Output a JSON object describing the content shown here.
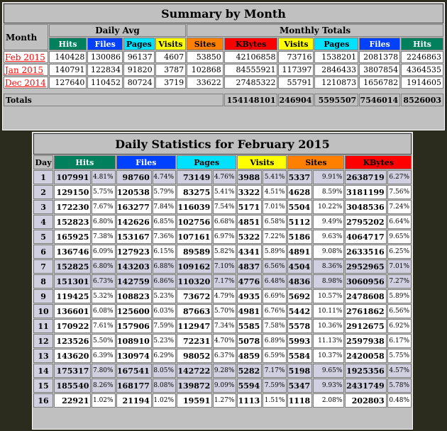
{
  "summary": {
    "title": "Summary by Month",
    "month_label": "Month",
    "daily_avg_label": "Daily Avg",
    "monthly_totals_label": "Monthly Totals",
    "daily_cols": [
      "Hits",
      "Files",
      "Pages",
      "Visits"
    ],
    "monthly_cols": [
      "Sites",
      "KBytes",
      "Visits",
      "Pages",
      "Files",
      "Hits"
    ],
    "rows": [
      {
        "month": "Feb 2015",
        "cells": [
          "140428",
          "130086",
          "96137",
          "4607",
          "53850",
          "42106858",
          "73716",
          "1538201",
          "2081378",
          "2246863"
        ]
      },
      {
        "month": "Jan 2015",
        "cells": [
          "140791",
          "122834",
          "91820",
          "3787",
          "102868",
          "84555921",
          "117397",
          "2846433",
          "3807854",
          "4364535"
        ]
      },
      {
        "month": "Dec 2014",
        "cells": [
          "127640",
          "110452",
          "80724",
          "3719",
          "33622",
          "27485322",
          "55791",
          "1210873",
          "1656782",
          "1914605"
        ]
      }
    ],
    "totals": {
      "label": "Totals",
      "cells": [
        "154148101",
        "246904",
        "5595507",
        "7546014",
        "8526003"
      ]
    }
  },
  "daily": {
    "title": "Daily Statistics for February 2015",
    "cols": [
      "Day",
      "Hits",
      "Files",
      "Pages",
      "Visits",
      "Sites",
      "KBytes"
    ],
    "rows": [
      {
        "day": "1",
        "cells": [
          "107991",
          "4.81%",
          "98760",
          "4.74%",
          "73149",
          "4.76%",
          "3988",
          "5.41%",
          "5337",
          "9.91%",
          "2638719",
          "6.27%"
        ]
      },
      {
        "day": "2",
        "cells": [
          "129150",
          "5.75%",
          "120538",
          "5.79%",
          "83275",
          "5.41%",
          "3322",
          "4.51%",
          "4628",
          "8.59%",
          "3181199",
          "7.56%"
        ]
      },
      {
        "day": "3",
        "cells": [
          "172230",
          "7.67%",
          "163277",
          "7.84%",
          "116039",
          "7.54%",
          "5171",
          "7.01%",
          "5504",
          "10.22%",
          "3048536",
          "7.24%"
        ]
      },
      {
        "day": "4",
        "cells": [
          "152823",
          "6.80%",
          "142626",
          "6.85%",
          "102756",
          "6.68%",
          "4851",
          "6.58%",
          "5112",
          "9.49%",
          "2795202",
          "6.64%"
        ]
      },
      {
        "day": "5",
        "cells": [
          "165925",
          "7.38%",
          "153167",
          "7.36%",
          "107161",
          "6.97%",
          "5322",
          "7.22%",
          "5186",
          "9.63%",
          "4064717",
          "9.65%"
        ]
      },
      {
        "day": "6",
        "cells": [
          "136746",
          "6.09%",
          "127923",
          "6.15%",
          "89589",
          "5.82%",
          "4341",
          "5.89%",
          "4891",
          "9.08%",
          "2633516",
          "6.25%"
        ]
      },
      {
        "day": "7",
        "cells": [
          "152825",
          "6.80%",
          "143203",
          "6.88%",
          "109162",
          "7.10%",
          "4837",
          "6.56%",
          "4504",
          "8.36%",
          "2952965",
          "7.01%"
        ]
      },
      {
        "day": "8",
        "cells": [
          "151301",
          "6.73%",
          "142759",
          "6.86%",
          "110320",
          "7.17%",
          "4776",
          "6.48%",
          "4836",
          "8.98%",
          "3060956",
          "7.27%"
        ]
      },
      {
        "day": "9",
        "cells": [
          "119425",
          "5.32%",
          "108823",
          "5.23%",
          "73672",
          "4.79%",
          "4935",
          "6.69%",
          "5692",
          "10.57%",
          "2478608",
          "5.89%"
        ]
      },
      {
        "day": "10",
        "cells": [
          "136601",
          "6.08%",
          "125600",
          "6.03%",
          "87663",
          "5.70%",
          "4981",
          "6.76%",
          "5442",
          "10.11%",
          "2761862",
          "6.56%"
        ]
      },
      {
        "day": "11",
        "cells": [
          "170922",
          "7.61%",
          "157906",
          "7.59%",
          "112947",
          "7.34%",
          "5585",
          "7.58%",
          "5578",
          "10.36%",
          "2912675",
          "6.92%"
        ]
      },
      {
        "day": "12",
        "cells": [
          "123526",
          "5.50%",
          "108910",
          "5.23%",
          "72231",
          "4.70%",
          "5078",
          "6.89%",
          "5993",
          "11.13%",
          "2597938",
          "6.17%"
        ]
      },
      {
        "day": "13",
        "cells": [
          "143620",
          "6.39%",
          "130974",
          "6.29%",
          "98052",
          "6.37%",
          "4859",
          "6.59%",
          "5584",
          "10.37%",
          "2420058",
          "5.75%"
        ]
      },
      {
        "day": "14",
        "cells": [
          "175317",
          "7.80%",
          "167541",
          "8.05%",
          "142722",
          "9.28%",
          "5282",
          "7.17%",
          "5198",
          "9.65%",
          "1925356",
          "4.57%"
        ]
      },
      {
        "day": "15",
        "cells": [
          "185540",
          "8.26%",
          "168177",
          "8.08%",
          "139872",
          "9.09%",
          "5594",
          "7.59%",
          "5347",
          "9.93%",
          "2431749",
          "5.78%"
        ]
      },
      {
        "day": "16",
        "cells": [
          "22921",
          "1.02%",
          "21194",
          "1.02%",
          "19591",
          "1.27%",
          "1113",
          "1.51%",
          "1118",
          "2.08%",
          "202803",
          "0.48%"
        ]
      }
    ],
    "weekend_days": [
      "1",
      "7",
      "8",
      "14",
      "15"
    ]
  },
  "colors": {
    "hits": "#00805c",
    "files": "#0040ff",
    "pages": "#00e0ff",
    "visits": "#ffff00",
    "sites": "#ff8000",
    "kbytes": "#ff0000",
    "link": "#ff0000",
    "weekend": "#d0d0e0"
  }
}
